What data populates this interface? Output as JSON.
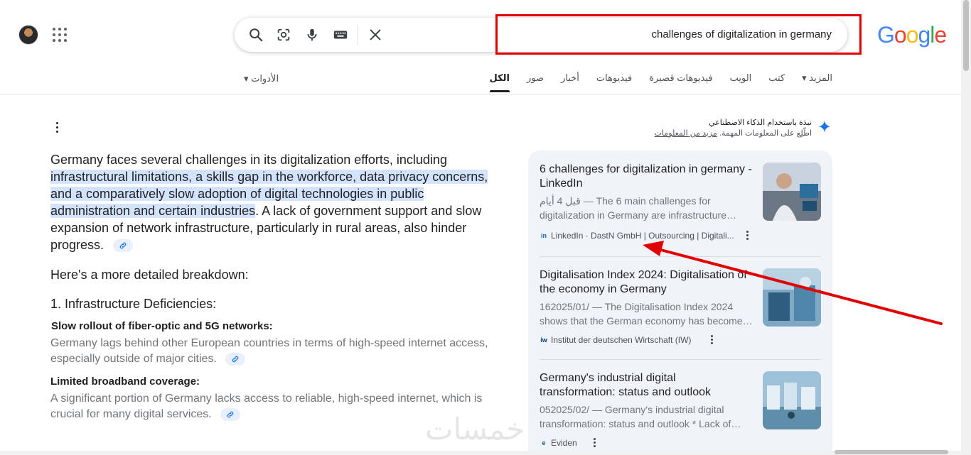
{
  "header": {
    "query": "challenges of digitalization in germany",
    "logo_letters": [
      "G",
      "o",
      "o",
      "g",
      "l",
      "e"
    ]
  },
  "tabs": [
    {
      "label": "الكل",
      "active": true
    },
    {
      "label": "صور"
    },
    {
      "label": "أخبار"
    },
    {
      "label": "فيديوهات"
    },
    {
      "label": "فيديوهات قصيرة"
    },
    {
      "label": "الويب"
    },
    {
      "label": "كتب"
    },
    {
      "label": "المزيد ▾"
    }
  ],
  "tools_label": "الأدوات ▾",
  "ai_overview": {
    "title": "نبذة باستخدام الذكاء الاصطناعي",
    "subtitle_prefix": "اطّلِع على المعلومات المهمة.",
    "subtitle_link": "مزيد من المعلومات"
  },
  "answer": {
    "lead_start": "Germany faces several challenges in its digitalization efforts, including ",
    "lead_highlight": "infrastructural limitations, a skills gap in the workforce, data privacy concerns, and a comparatively slow adoption of digital technologies in public administration and certain industries",
    "lead_end": ". A lack of government support and slow expansion of network infrastructure, particularly in rural areas, also hinder progress.",
    "breakdown_heading": "Here's a more detailed breakdown:",
    "section1_heading": "1. Infrastructure Deficiencies:",
    "items": [
      {
        "title": "Slow rollout of fiber-optic and 5G networks:",
        "text": "Germany lags behind other European countries in terms of high-speed internet access, especially outside of major cities."
      },
      {
        "title": "Limited broadband coverage:",
        "text": "A significant portion of Germany lacks access to reliable, high-speed internet, which is crucial for many digital services."
      }
    ]
  },
  "sources": [
    {
      "title": "6 challenges for digitalization in germany - LinkedIn",
      "snippet": "قبل 4 أيام — The 6 main challenges for digitalization in Germany are infrastructure…",
      "site": "LinkedIn · DastN GmbH | Outsourcing | Digitali...",
      "favicon": "in"
    },
    {
      "title": "Digitalisation Index 2024: Digitalisation of the economy in Germany",
      "snippet": "162025/01/ — The Digitalisation Index 2024 shows that the German economy has become…",
      "site": "Institut der deutschen Wirtschaft (IW)",
      "favicon": "iw"
    },
    {
      "title": "Germany's industrial digital transformation: status and outlook",
      "snippet": "052025/02/ — Germany's industrial digital transformation: status and outlook * Lack of…",
      "site": "Eviden",
      "favicon": "e"
    }
  ],
  "watermark": "خمسات",
  "colors": {
    "accent_blue": "#1a73e8",
    "highlight": "#d3e3fd",
    "panel_bg": "#f0f4f9",
    "annotation_red": "#e00000"
  }
}
